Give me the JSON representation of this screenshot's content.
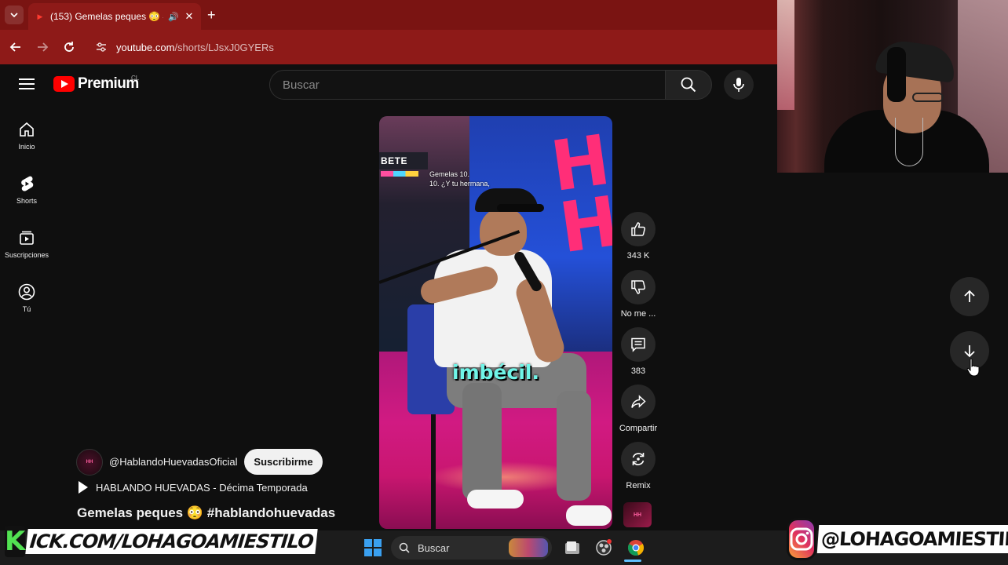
{
  "browser": {
    "tab": {
      "title": "(153) Gemelas peques 😳 #",
      "favicon": "youtube-favicon",
      "audio_icon": "speaker-icon"
    },
    "new_tab_icon": "plus-icon",
    "url_host": "youtube.com",
    "url_path": "/shorts/LJsxJ0GYERs"
  },
  "header": {
    "logo_text": "Premium",
    "country_code": "CL",
    "search_placeholder": "Buscar"
  },
  "sidebar": {
    "items": [
      {
        "label": "Inicio",
        "icon": "home-icon"
      },
      {
        "label": "Shorts",
        "icon": "shorts-icon"
      },
      {
        "label": "Suscripciones",
        "icon": "subscriptions-icon"
      },
      {
        "label": "Tú",
        "icon": "account-icon"
      }
    ]
  },
  "video": {
    "sign_text": "BETE",
    "overlay_caption": "Gemelas 10.\n10. ¿Y tu hermana,",
    "subtitle": "imbécil."
  },
  "actions": {
    "like_count": "343 K",
    "dislike_label": "No me ...",
    "comment_count": "383",
    "share_label": "Compartir",
    "remix_label": "Remix"
  },
  "channel": {
    "name": "@HablandoHuevadasOficial",
    "subscribe_label": "Suscribirme",
    "playlist": "HABLANDO HUEVADAS - Décima Temporada",
    "video_title": "Gemelas peques 😳 #hablandohuevadas"
  },
  "taskbar": {
    "search_label": "Buscar"
  },
  "overlays": {
    "kick_letter": "K",
    "kick_text": "ICK.COM/LOHAGOAMIESTILO",
    "instagram_handle": "@LOHAGOAMIESTILO"
  },
  "colors": {
    "browser_accent": "#8e1a18",
    "youtube_red": "#ff0000",
    "subtitle_cyan": "#6ff5e8",
    "kick_green": "#52e252"
  }
}
